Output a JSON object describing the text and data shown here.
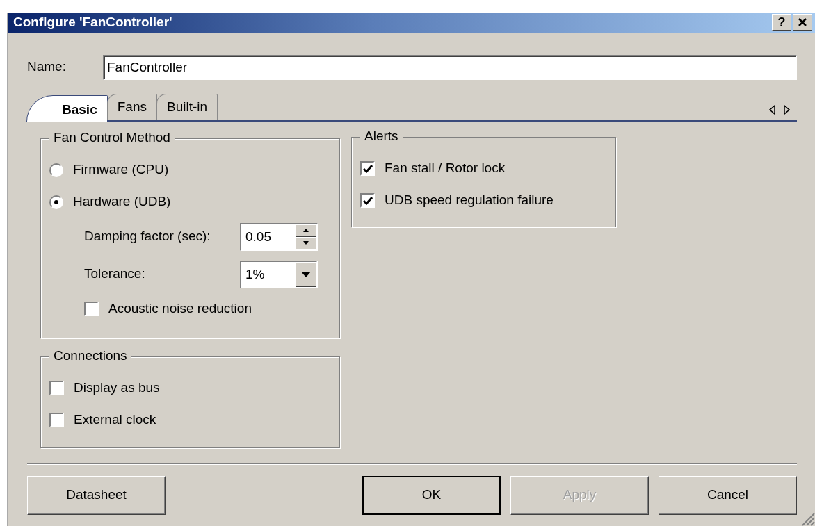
{
  "window": {
    "title": "Configure 'FanController'",
    "help_label": "?"
  },
  "name_field": {
    "label": "Name:",
    "value": "FanController"
  },
  "tabs": [
    {
      "label": "Basic",
      "selected": true
    },
    {
      "label": "Fans",
      "selected": false
    },
    {
      "label": "Built-in",
      "selected": false
    }
  ],
  "fan_control_method": {
    "title": "Fan Control Method",
    "options": [
      {
        "label": "Firmware (CPU)",
        "selected": false
      },
      {
        "label": "Hardware (UDB)",
        "selected": true
      }
    ],
    "damping_factor": {
      "label": "Damping factor (sec):",
      "value": "0.05"
    },
    "tolerance": {
      "label": "Tolerance:",
      "value": "1%"
    },
    "acoustic_noise_reduction": {
      "label": "Acoustic noise reduction",
      "checked": false
    }
  },
  "alerts": {
    "title": "Alerts",
    "items": [
      {
        "label": "Fan stall / Rotor lock",
        "checked": true
      },
      {
        "label": "UDB speed regulation failure",
        "checked": true
      }
    ]
  },
  "connections": {
    "title": "Connections",
    "items": [
      {
        "label": "Display as bus",
        "checked": false
      },
      {
        "label": "External clock",
        "checked": false
      }
    ]
  },
  "buttons": [
    {
      "label": "Datasheet",
      "default": false,
      "disabled": false
    },
    {
      "label": "OK",
      "default": true,
      "disabled": false
    },
    {
      "label": "Apply",
      "default": false,
      "disabled": true
    },
    {
      "label": "Cancel",
      "default": false,
      "disabled": false
    }
  ]
}
